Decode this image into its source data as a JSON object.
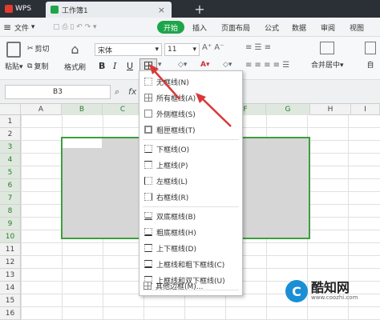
{
  "titlebar": {
    "app": "WPS",
    "doc": "工作簿1"
  },
  "menu": {
    "file": "文件",
    "start": "开始",
    "insert": "插入",
    "page_layout": "页面布局",
    "formula": "公式",
    "data": "数据",
    "review": "审阅",
    "view": "视图"
  },
  "ribbon": {
    "cut": "剪切",
    "paste": "粘贴",
    "copy": "复制",
    "format_painter": "格式刷",
    "font_name": "宋体",
    "font_size": "11",
    "bold": "B",
    "italic": "I",
    "underline": "U",
    "merge_center": "合并居中",
    "auto": "自"
  },
  "formulabar": {
    "cell_ref": "B3"
  },
  "columns": [
    "A",
    "B",
    "C",
    "D",
    "E",
    "F",
    "G",
    "H",
    "I"
  ],
  "rows": [
    "1",
    "2",
    "3",
    "4",
    "5",
    "6",
    "7",
    "8",
    "9",
    "10",
    "11",
    "12",
    "13",
    "14",
    "15",
    "16"
  ],
  "border_menu": [
    {
      "label": "无框线(N)",
      "icon": "no-border"
    },
    {
      "label": "所有框线(A)",
      "icon": "all-borders"
    },
    {
      "label": "外侧框线(S)",
      "icon": "outside-borders"
    },
    {
      "label": "粗匣框线(T)",
      "icon": "thick-box-border"
    },
    {
      "label": "下框线(O)",
      "icon": "bottom-border"
    },
    {
      "label": "上框线(P)",
      "icon": "top-border"
    },
    {
      "label": "左框线(L)",
      "icon": "left-border"
    },
    {
      "label": "右框线(R)",
      "icon": "right-border"
    },
    {
      "label": "双底框线(B)",
      "icon": "double-bottom-border"
    },
    {
      "label": "粗底框线(H)",
      "icon": "thick-bottom-border"
    },
    {
      "label": "上下框线(D)",
      "icon": "top-bottom-border"
    },
    {
      "label": "上框线和粗下框线(C)",
      "icon": "top-thick-bottom-border"
    },
    {
      "label": "上框线和双下框线(U)",
      "icon": "top-double-bottom-border"
    },
    {
      "label": "其他边框(M)...",
      "icon": "more-borders"
    }
  ],
  "watermark": {
    "brand": "酷知网",
    "url": "www.coozhi.com"
  },
  "colors": {
    "accent": "#1ea54a",
    "selection_border": "#3e9e3e",
    "arrow": "#d9383a"
  }
}
